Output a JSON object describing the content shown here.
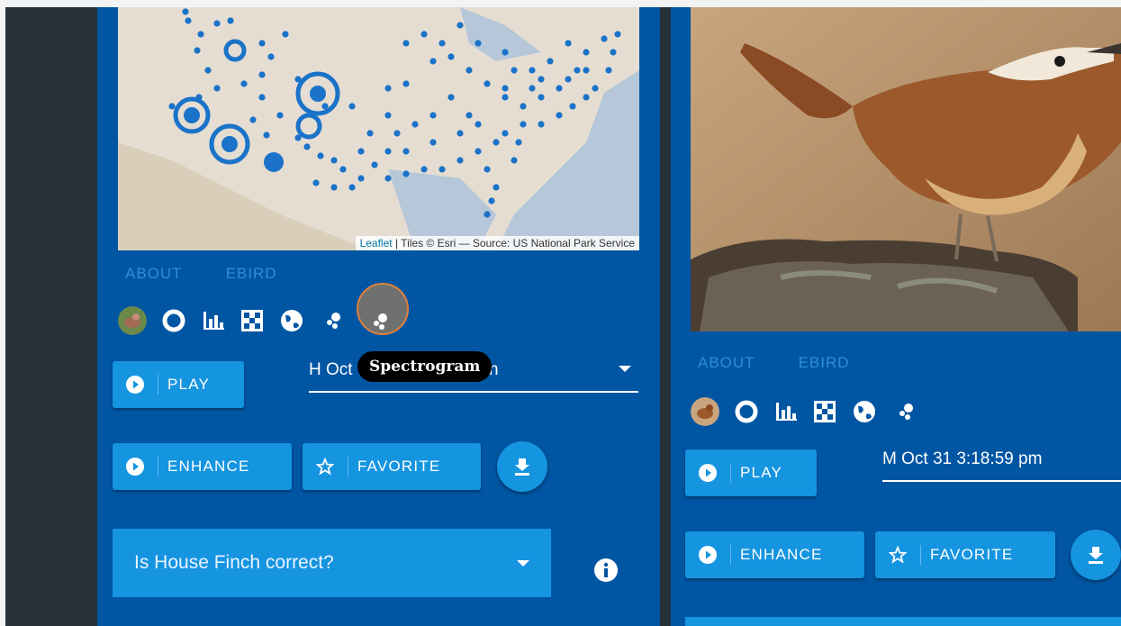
{
  "left_card": {
    "map": {
      "attribution_link": "Leaflet",
      "attribution_text": " | Tiles © Esri — Source: US National Park Service"
    },
    "tabs": [
      "ABOUT",
      "EBIRD"
    ],
    "icons": [
      "bird-avatar",
      "donut-chart-icon",
      "bar-chart-icon",
      "checkerboard-icon",
      "globe-icon",
      "spectrogram-icon"
    ],
    "play_label": "PLAY",
    "time_select_value": "H Oct",
    "time_select_tail": "n",
    "enhance_label": "ENHANCE",
    "favorite_label": "FAVORITE",
    "question_text": "Is House Finch correct?",
    "tooltip": "Spectrogram"
  },
  "right_card": {
    "tabs": [
      "ABOUT",
      "EBIRD"
    ],
    "icons": [
      "bird-avatar",
      "donut-chart-icon",
      "bar-chart-icon",
      "checkerboard-icon",
      "globe-icon",
      "spectrogram-icon"
    ],
    "play_label": "PLAY",
    "time_select_value": "M Oct 31 3:18:59 pm",
    "enhance_label": "ENHANCE",
    "favorite_label": "FAVORITE"
  },
  "colors": {
    "card_bg": "#0056a3",
    "button_bg": "#1594e0",
    "tab_text": "#2d8fd8",
    "sidebar": "#263238",
    "map_point": "#1a73c8"
  }
}
